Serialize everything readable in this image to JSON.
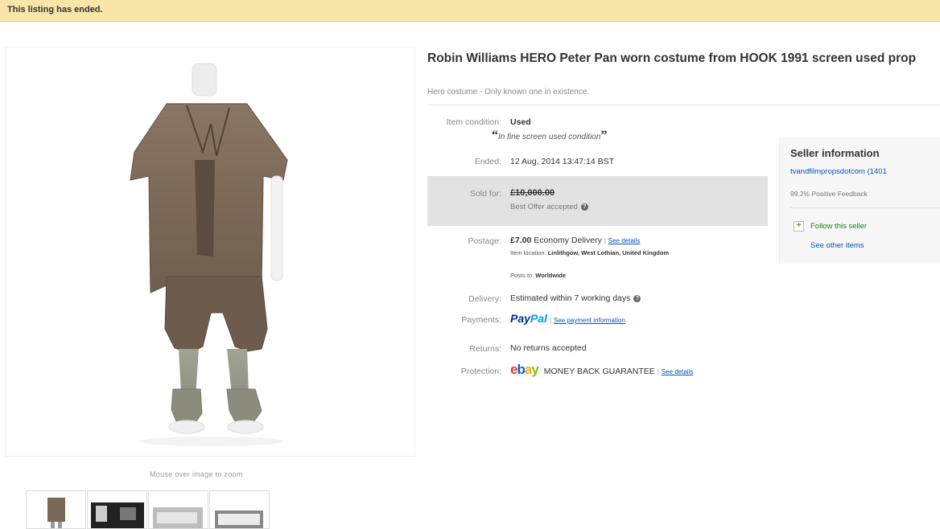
{
  "banner": {
    "text": "This listing has ended."
  },
  "gallery": {
    "zoom_hint": "Mouse over image to zoom"
  },
  "listing": {
    "title": "Robin Williams HERO Peter Pan worn costume from HOOK 1991 screen used prop",
    "subtitle": "Hero costume - Only known one in existence."
  },
  "details": {
    "condition_label": "Item condition:",
    "condition_value": "Used",
    "condition_note": "In fine screen used condition",
    "ended_label": "Ended:",
    "ended_value": "12 Aug, 2014   13:47:14 BST",
    "sold_label": "Sold for:",
    "sold_price": "£10,000.00",
    "best_offer": "Best Offer accepted",
    "postage_label": "Postage:",
    "postage_price": "£7.00",
    "postage_service": "Economy Delivery",
    "postage_link": "See details",
    "item_location_label": "Item location:",
    "item_location_value": "Linlithgow, West Lothian, United Kingdom",
    "posts_to_label": "Posts to:",
    "posts_to_value": "Worldwide",
    "delivery_label": "Delivery:",
    "delivery_value": "Estimated within 7 working days",
    "payments_label": "Payments:",
    "paypal_pay": "Pay",
    "paypal_pal": "Pal",
    "payments_link": "See payment information",
    "returns_label": "Returns:",
    "returns_value": "No returns accepted",
    "protection_label": "Protection:",
    "protection_value": "MONEY BACK GUARANTEE",
    "protection_link": "See details",
    "ebay_e": "e",
    "ebay_b": "b",
    "ebay_a": "a",
    "ebay_y": "y"
  },
  "seller": {
    "title": "Seller information",
    "name": "tvandfilmpropsdotcom (1401",
    "feedback": "99.2% Positive Feedback",
    "follow": "Follow this seller",
    "see_other": "See other items"
  },
  "colors": {
    "banner_bg": "#f8e5a8",
    "price_box_bg": "#e2e2e2",
    "link": "#0654ba"
  }
}
